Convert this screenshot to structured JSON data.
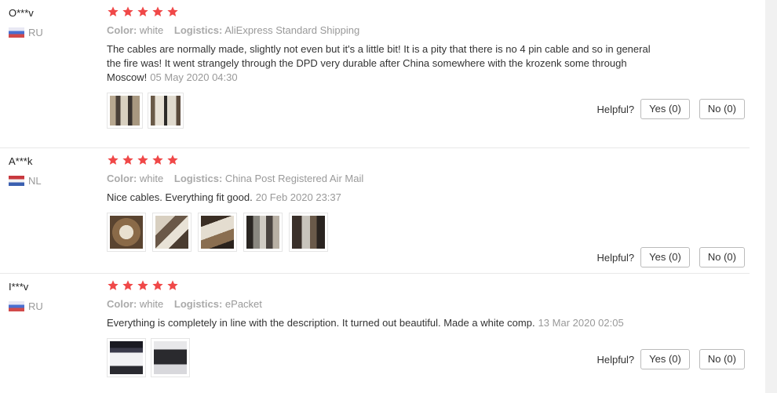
{
  "reviews": [
    {
      "user": "O***v",
      "country": "RU",
      "rating": 5,
      "color_label": "Color:",
      "color": "white",
      "logistics_label": "Logistics:",
      "logistics": "AliExpress Standard Shipping",
      "text": "The cables are normally made, slightly not even but it's a little bit! It is a pity that there is no 4 pin cable and so in general the fire was! It went strangely through the DPD very durable after China somewhere with the krozenk some through Moscow!",
      "date": "05 May 2020 04:30",
      "photos": [
        "cable-photo-1",
        "cable-photo-2"
      ],
      "helpful_label": "Helpful?",
      "yes": "Yes (0)",
      "no": "No (0)"
    },
    {
      "user": "A***k",
      "country": "NL",
      "rating": 5,
      "color_label": "Color:",
      "color": "white",
      "logistics_label": "Logistics:",
      "logistics": "China Post Registered Air Mail",
      "text": "Nice cables. Everything fit good.",
      "date": "20 Feb 2020 23:37",
      "photos": [
        "cable-photo-1",
        "cable-photo-2",
        "cable-photo-3",
        "pc-build-photo-1",
        "pc-build-photo-2"
      ],
      "helpful_label": "Helpful?",
      "yes": "Yes (0)",
      "no": "No (0)"
    },
    {
      "user": "I***v",
      "country": "RU",
      "rating": 5,
      "color_label": "Color:",
      "color": "white",
      "logistics_label": "Logistics:",
      "logistics": "ePacket",
      "text": "Everything is completely in line with the description. It turned out beautiful. Made a white comp.",
      "date": "13 Mar 2020 02:05",
      "photos": [
        "pc-case-photo-1",
        "pc-case-photo-2"
      ],
      "helpful_label": "Helpful?",
      "yes": "Yes (0)",
      "no": "No (0)"
    }
  ],
  "colors": {
    "star": "#f04848",
    "flag_ru": "#4a6fd0",
    "flag_nl": "#c8383e"
  }
}
